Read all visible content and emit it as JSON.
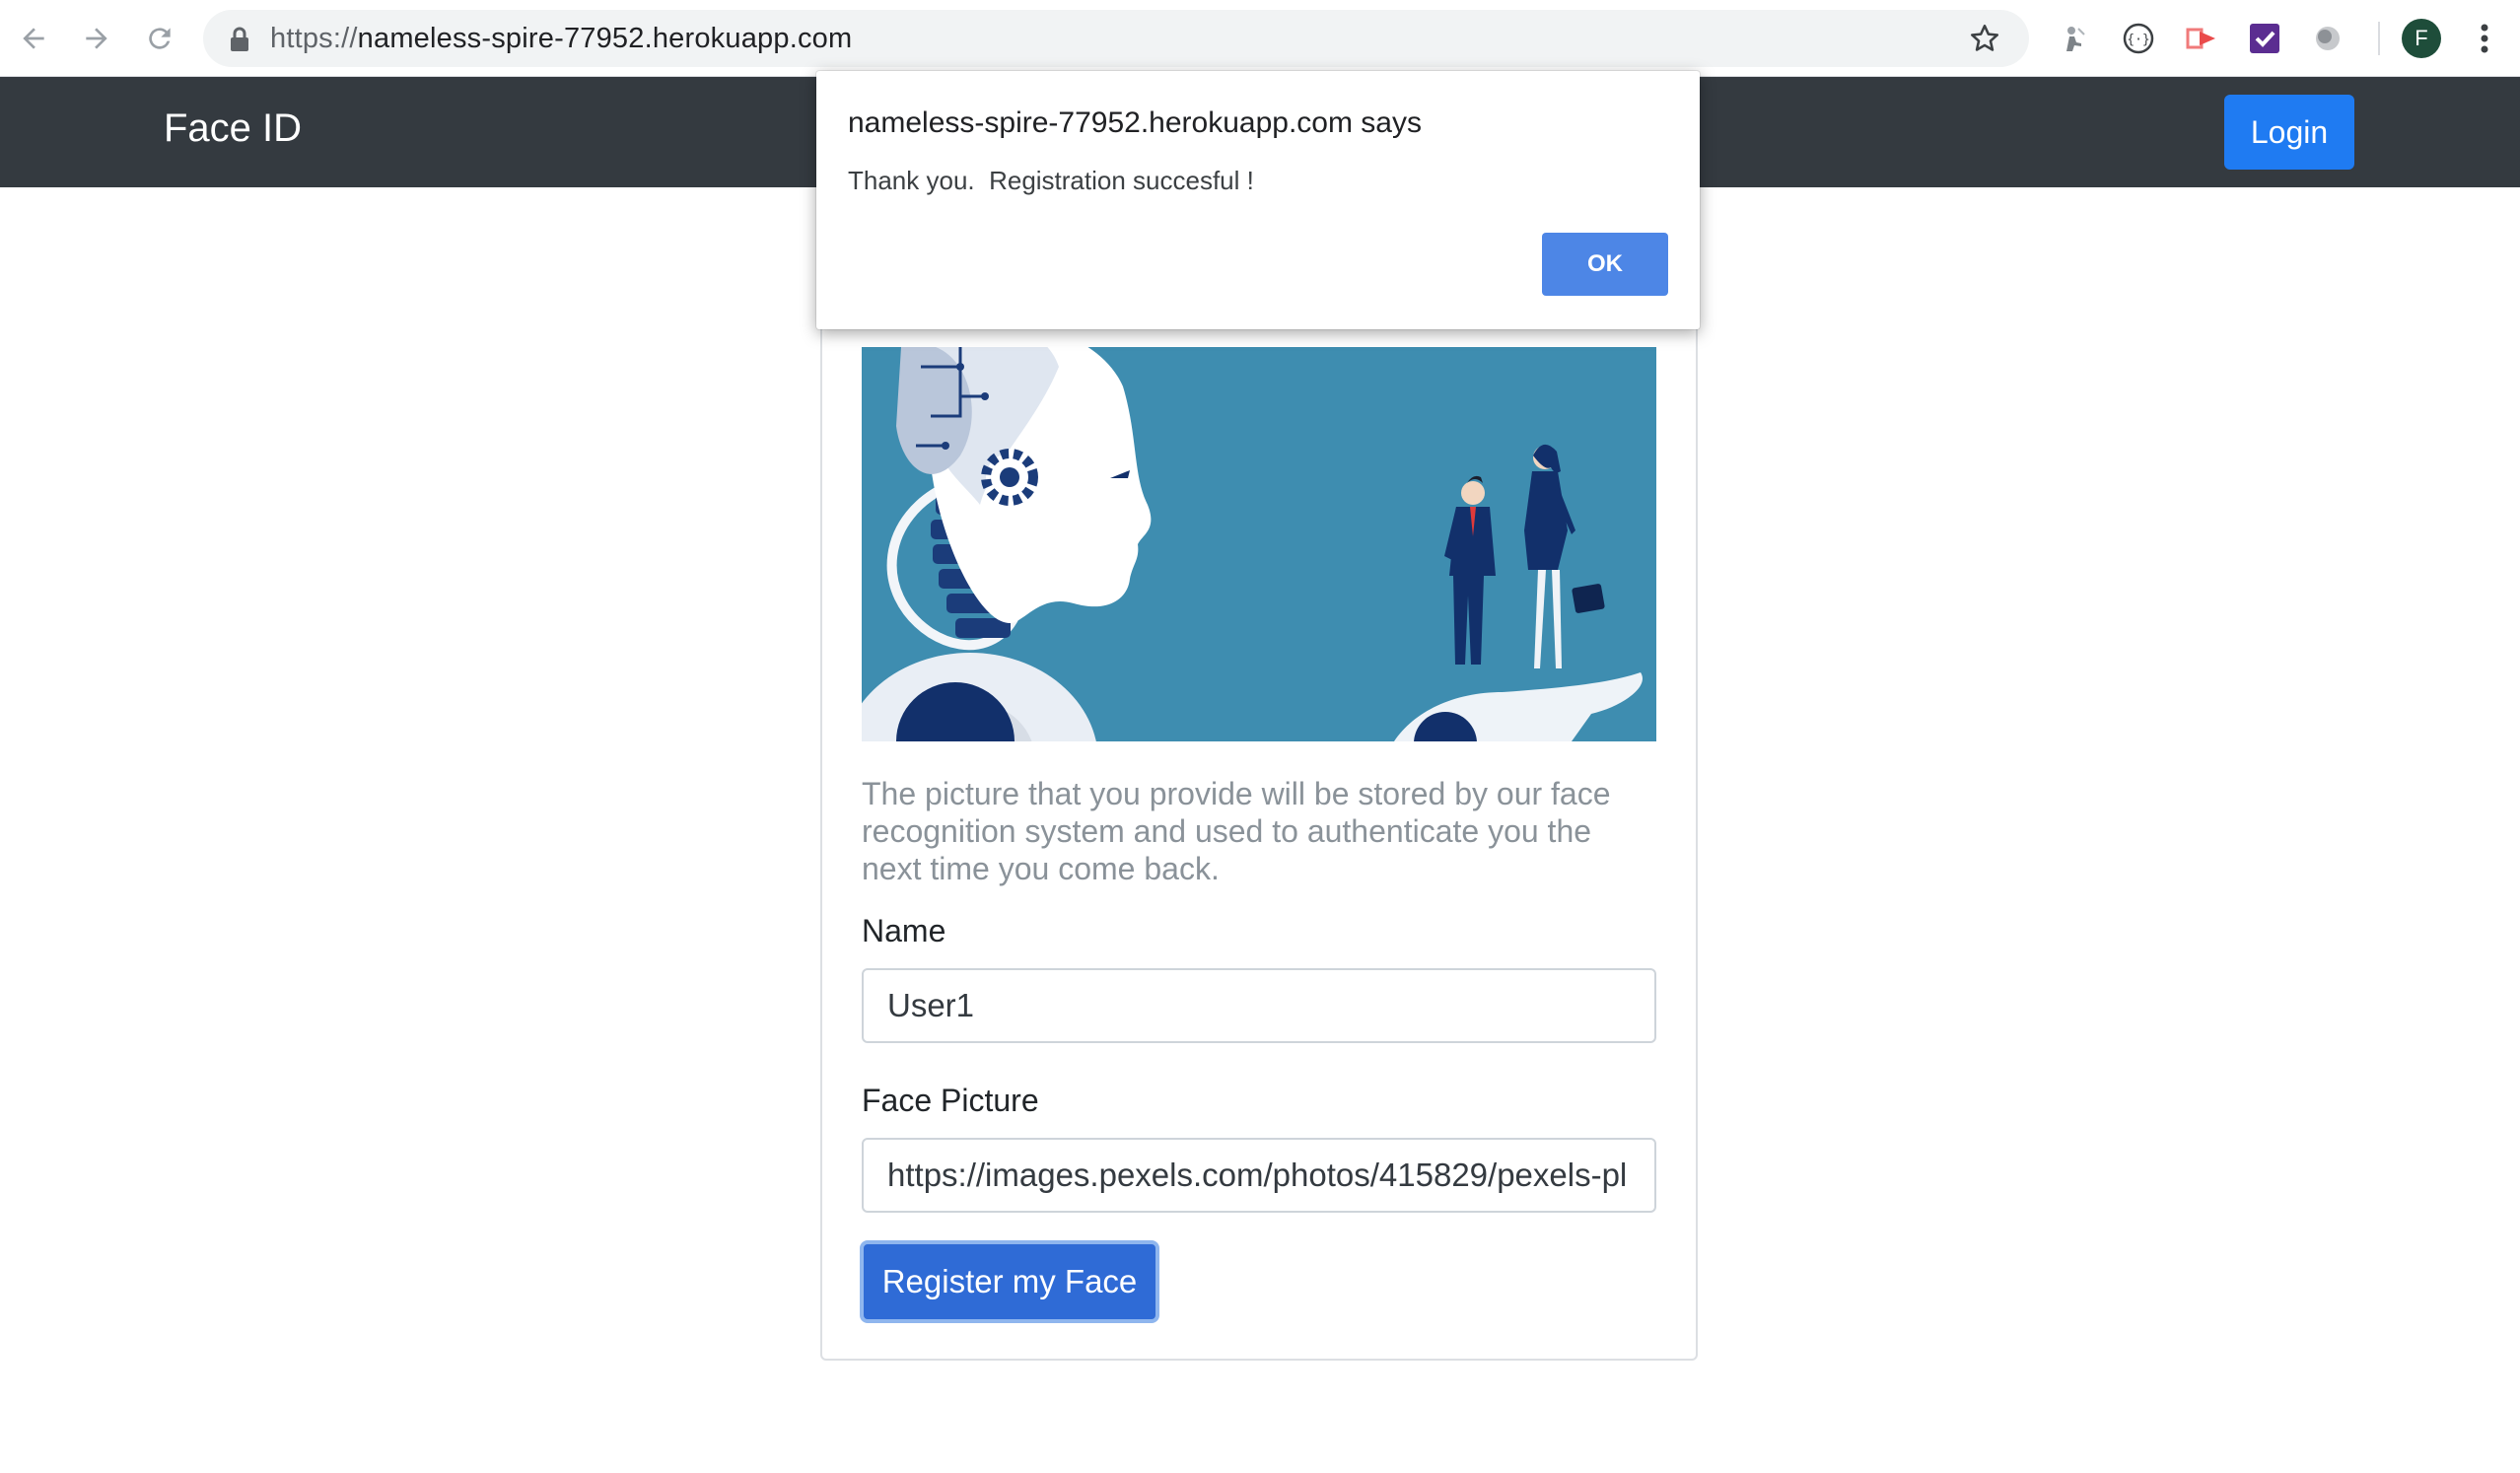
{
  "browser": {
    "url_scheme": "https://",
    "url_host": "nameless-spire-77952.herokuapp.com",
    "profile_initial": "F",
    "icons": [
      "back-arrow-icon",
      "forward-arrow-icon",
      "reload-icon",
      "lock-icon",
      "star-icon",
      "extension-icons",
      "kebab-menu-icon"
    ]
  },
  "navbar": {
    "brand": "Face ID",
    "login_label": "Login"
  },
  "card": {
    "description": "The picture that you provide will be stored by our face recognition system and used to authenticate you the next time you come back.",
    "name_label": "Name",
    "name_value": "User1",
    "picture_label": "Face Picture",
    "picture_value": "https://images.pexels.com/photos/415829/pexels-pl",
    "submit_label": "Register my Face"
  },
  "dialog": {
    "title": "nameless-spire-77952.herokuapp.com says",
    "message": "Thank you.  Registration succesful !",
    "ok_label": "OK"
  },
  "colors": {
    "navbar_bg": "#343a40",
    "primary": "#1f7bf2",
    "hero_bg": "#3e8db0"
  }
}
